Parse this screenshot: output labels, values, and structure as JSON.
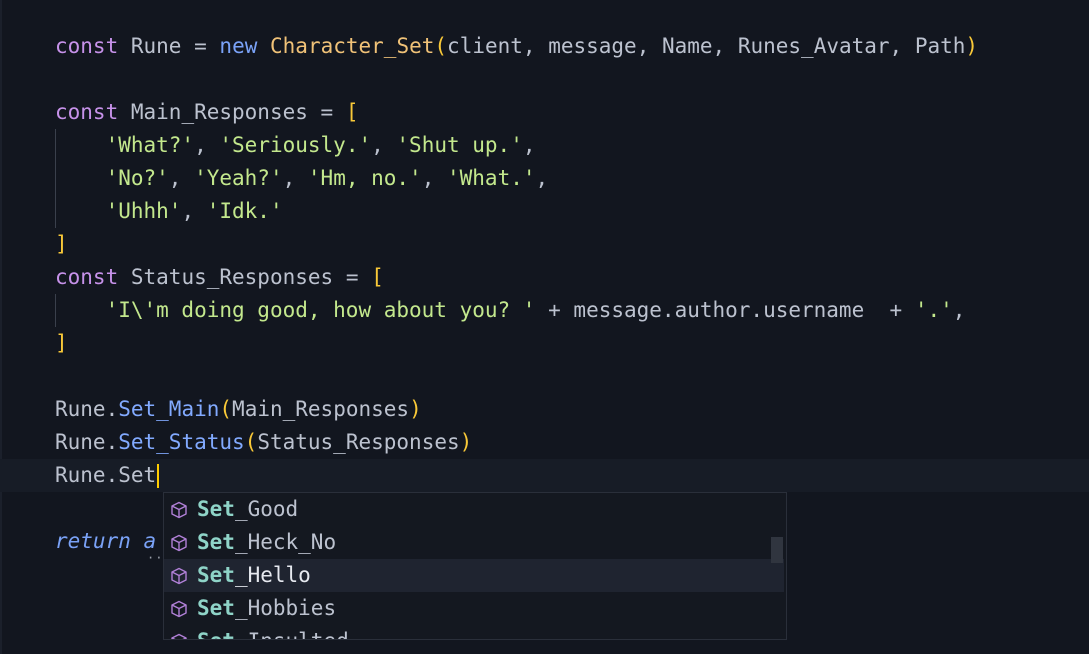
{
  "editor": {
    "lines": {
      "l1": {
        "kw": "const",
        "name": "Rune",
        "eq": "=",
        "new": "new",
        "cls": "Character_Set",
        "open": "(",
        "args": "client, message, Name, Runes_Avatar, Path",
        "close": ")"
      },
      "l3": {
        "kw": "const",
        "name": "Main_Responses",
        "eq": "=",
        "open": "["
      },
      "l4": {
        "s1": "'What?'",
        "s2": "'Seriously.'",
        "s3": "'Shut up.'"
      },
      "l5": {
        "s1": "'No?'",
        "s2": "'Yeah?'",
        "s3": "'Hm, no.'",
        "s4": "'What.'"
      },
      "l6": {
        "s1": "'Uhhh'",
        "s2": "'Idk.'"
      },
      "l7": {
        "close": "]"
      },
      "l8": {
        "kw": "const",
        "name": "Status_Responses",
        "eq": "=",
        "open": "["
      },
      "l9": {
        "s1": "'I\\'m doing good, how about you? '",
        "plus1": "+",
        "expr": "message.author.username",
        "plus2": "+",
        "s2": "'.'",
        "comma": ","
      },
      "l10": {
        "close": "]"
      },
      "l12": {
        "obj": "Rune",
        "method": "Set_Main",
        "open": "(",
        "arg": "Main_Responses",
        "close": ")"
      },
      "l13": {
        "obj": "Rune",
        "method": "Set_Status",
        "open": "(",
        "arg": "Status_Responses",
        "close": ")"
      },
      "l14": {
        "obj": "Rune",
        "typed": "Set"
      },
      "l16": {
        "kw": "return",
        "partial": "a"
      }
    }
  },
  "suggestions": {
    "match_prefix": "Set",
    "selected_index": 2,
    "icon": "symbol-method-cube-icon",
    "items": [
      {
        "match": "Set",
        "rest": "_Good"
      },
      {
        "match": "Set",
        "rest": "_Heck_No"
      },
      {
        "match": "Set",
        "rest": "_Hello"
      },
      {
        "match": "Set",
        "rest": "_Hobbies"
      },
      {
        "match": "Set",
        "rest": "_Insulted"
      }
    ]
  },
  "colors": {
    "background": "#12161f",
    "keyword": "#c792ea",
    "string": "#c3e88d",
    "class": "#f0c278",
    "method": "#82aaff",
    "cursor": "#ffcc00",
    "suggest_match": "#8fd4c8",
    "suggest_icon": "#b180d7"
  }
}
